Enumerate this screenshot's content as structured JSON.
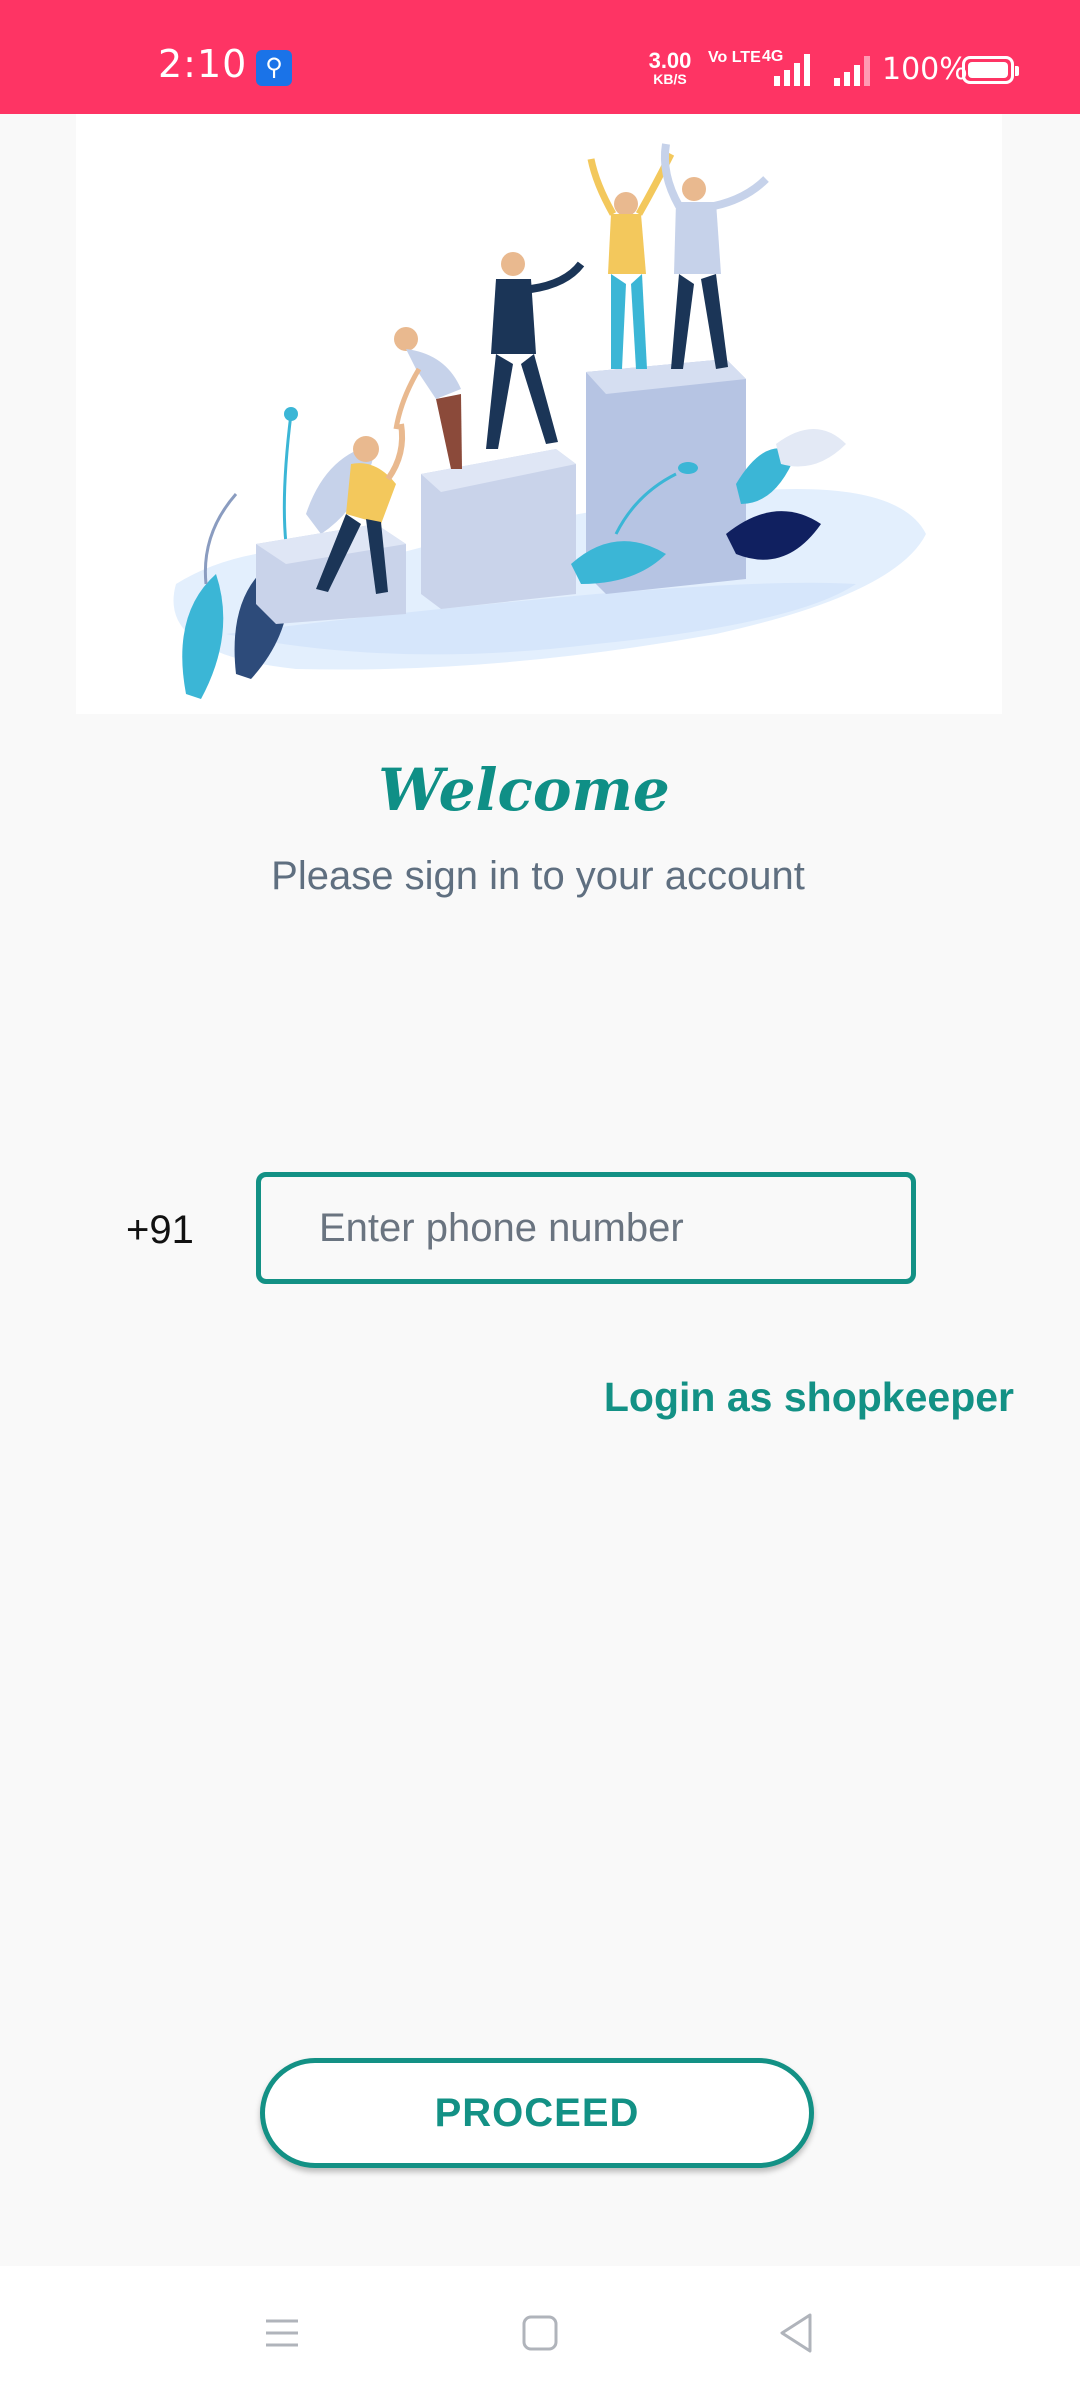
{
  "status_bar": {
    "time": "2:10",
    "network_speed": "3.00",
    "network_speed_unit": "KB/S",
    "volte": "Vo LTE",
    "network_type": "4G",
    "battery_percent": "100%",
    "background_color": "#fe3464"
  },
  "hero": {
    "illustration": "teamwork-climbing-podium"
  },
  "welcome": {
    "title": "Welcome",
    "subtitle": "Please sign in to your account"
  },
  "login_form": {
    "country_code": "+91",
    "phone_placeholder": "Enter phone number",
    "phone_value": ""
  },
  "links": {
    "shopkeeper_login": "Login as shopkeeper"
  },
  "actions": {
    "proceed_label": "PROCEED"
  },
  "theme": {
    "accent": "#139185",
    "subtitle_color": "#5f6f80"
  },
  "nav_bar": {
    "icons": [
      "menu-icon",
      "home-icon",
      "back-icon"
    ]
  }
}
